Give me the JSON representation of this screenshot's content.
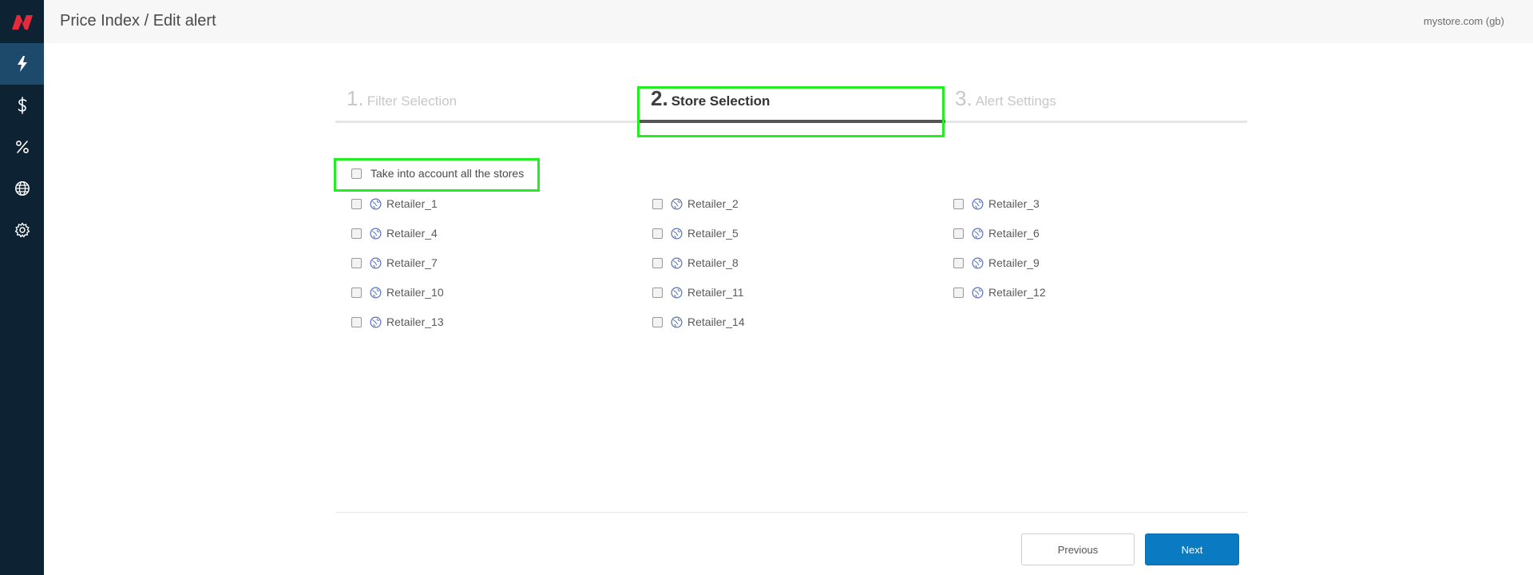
{
  "header": {
    "title": "Price Index / Edit alert",
    "store": "mystore.com (gb)"
  },
  "sidebar": {
    "items": [
      {
        "name": "lightning-icon"
      },
      {
        "name": "dollar-icon"
      },
      {
        "name": "percent-icon"
      },
      {
        "name": "globe-icon"
      },
      {
        "name": "gear-icon"
      }
    ]
  },
  "steps": [
    {
      "number": "1.",
      "label": "Filter Selection"
    },
    {
      "number": "2.",
      "label": "Store Selection"
    },
    {
      "number": "3.",
      "label": "Alert Settings"
    }
  ],
  "select_all": {
    "label": "Take into account all the stores"
  },
  "retailers": [
    "Retailer_1",
    "Retailer_2",
    "Retailer_3",
    "Retailer_4",
    "Retailer_5",
    "Retailer_6",
    "Retailer_7",
    "Retailer_8",
    "Retailer_9",
    "Retailer_10",
    "Retailer_11",
    "Retailer_12",
    "Retailer_13",
    "Retailer_14"
  ],
  "buttons": {
    "previous": "Previous",
    "next": "Next"
  },
  "colors": {
    "sidebar": "#0d2233",
    "accent": "#0a7ac2",
    "highlight": "#22ee22",
    "logo": "#e8293b"
  }
}
